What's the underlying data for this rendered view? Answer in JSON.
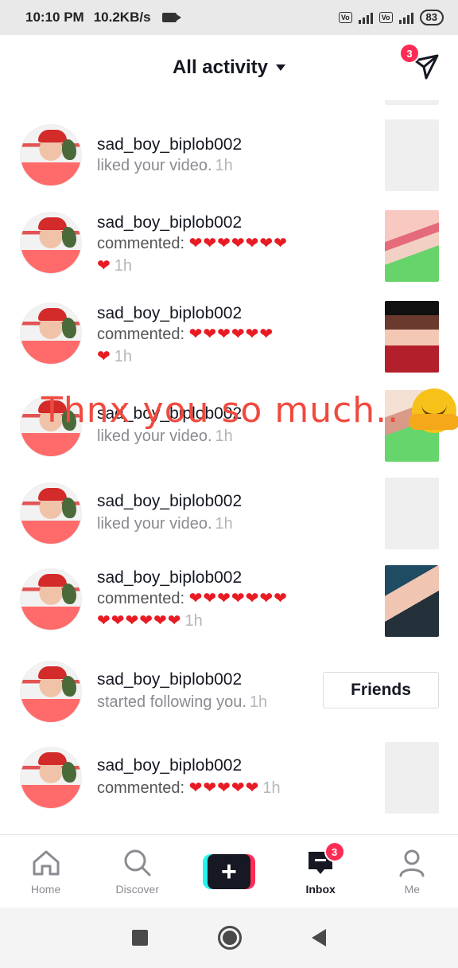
{
  "status_bar": {
    "time": "10:10 PM",
    "speed": "10.2KB/s",
    "sim1_label": "VoLTE",
    "sim2_label": "VoLTE",
    "network": "4G",
    "battery": "83"
  },
  "header": {
    "title": "All activity",
    "send_badge": "3"
  },
  "activities": [
    {
      "username": "sad_boy_biplob002",
      "action": "liked your video.",
      "time": "1h"
    },
    {
      "username": "sad_boy_biplob002",
      "action": "commented:",
      "hearts_line1": "❤❤❤❤❤❤❤",
      "hearts_line2": "❤",
      "time": "1h"
    },
    {
      "username": "sad_boy_biplob002",
      "action": "commented:",
      "hearts_line1": "❤❤❤❤❤❤",
      "hearts_line2": "❤",
      "time": "1h"
    },
    {
      "username": "sad_boy_biplob002",
      "action": "liked your video.",
      "time": "1h"
    },
    {
      "username": "sad_boy_biplob002",
      "action": "liked your video.",
      "time": "1h"
    },
    {
      "username": "sad_boy_biplob002",
      "action": "commented:",
      "hearts_line1": "❤❤❤❤❤❤❤",
      "hearts_line2": "❤❤❤❤❤❤",
      "time": "1h"
    },
    {
      "username": "sad_boy_biplob002",
      "action": "started following you.",
      "time": "1h",
      "button": "Friends"
    },
    {
      "username": "sad_boy_biplob002",
      "action": "commented:",
      "hearts_line1": "❤❤❤❤❤",
      "time": "1h"
    }
  ],
  "overlay": {
    "text": "Thnx you so much.."
  },
  "bottom_nav": {
    "home": "Home",
    "discover": "Discover",
    "create": "+",
    "inbox": "Inbox",
    "inbox_badge": "3",
    "me": "Me"
  },
  "colors": {
    "accent": "#fe2c55",
    "cyan": "#25f4ee",
    "heart": "#e81b23",
    "overlay_text": "#f04a3f"
  }
}
